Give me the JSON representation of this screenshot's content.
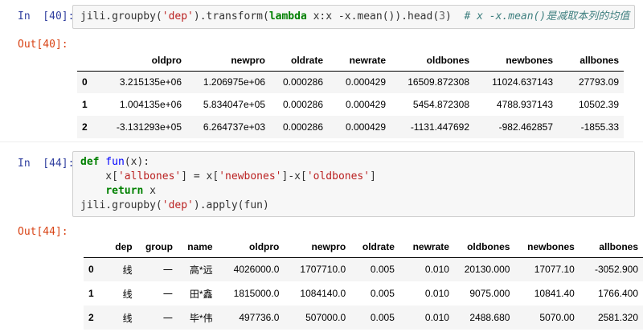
{
  "cell40": {
    "in_prompt": "In  [40]:",
    "out_prompt": "Out[40]:",
    "code": {
      "l1": "jili.groupby(",
      "l1_str": "'dep'",
      "l1b": ").transform(",
      "l1_kw": "lambda",
      "l1c": " x:x -x.mean()).head(",
      "l1_num": "3",
      "l1d": ")  ",
      "l1_comment": "# x -x.mean()是减取本列的均值"
    },
    "table": {
      "columns": [
        "",
        "oldpro",
        "newpro",
        "oldrate",
        "newrate",
        "oldbones",
        "newbones",
        "allbones"
      ],
      "rows": [
        [
          "0",
          "3.215135e+06",
          "1.206975e+06",
          "0.000286",
          "0.000429",
          "16509.872308",
          "11024.637143",
          "27793.09"
        ],
        [
          "1",
          "1.004135e+06",
          "5.834047e+05",
          "0.000286",
          "0.000429",
          "5454.872308",
          "4788.937143",
          "10502.39"
        ],
        [
          "2",
          "-3.131293e+05",
          "6.264737e+03",
          "0.000286",
          "0.000429",
          "-1131.447692",
          "-982.462857",
          "-1855.33"
        ]
      ]
    }
  },
  "cell44": {
    "in_prompt": "In  [44]:",
    "out_prompt": "Out[44]:",
    "code": {
      "l1_kw": "def",
      "l1_fn": " fun",
      "l1b": "(x):",
      "l2a": "    x[",
      "l2_str1": "'allbones'",
      "l2b": "] = x[",
      "l2_str2": "'newbones'",
      "l2c": "]-x[",
      "l2_str3": "'oldbones'",
      "l2d": "]",
      "l3a": "    ",
      "l3_kw": "return",
      "l3b": " x",
      "l4a": "jili.groupby(",
      "l4_str": "'dep'",
      "l4b": ").apply(fun)"
    },
    "table": {
      "columns": [
        "",
        "dep",
        "group",
        "name",
        "oldpro",
        "newpro",
        "oldrate",
        "newrate",
        "oldbones",
        "newbones",
        "allbones"
      ],
      "rows": [
        [
          "0",
          "线",
          "一",
          "高*远",
          "4026000.0",
          "1707710.0",
          "0.005",
          "0.010",
          "20130.000",
          "17077.10",
          "-3052.900"
        ],
        [
          "1",
          "线",
          "一",
          "田*鑫",
          "1815000.0",
          "1084140.0",
          "0.005",
          "0.010",
          "9075.000",
          "10841.40",
          "1766.400"
        ],
        [
          "2",
          "线",
          "一",
          "毕*伟",
          "497736.0",
          "507000.0",
          "0.005",
          "0.010",
          "2488.680",
          "5070.00",
          "2581.320"
        ]
      ]
    }
  }
}
